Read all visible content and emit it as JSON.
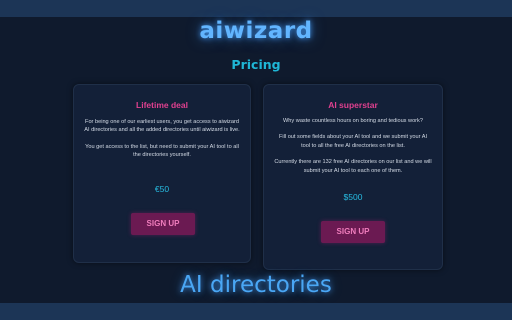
{
  "brand": "aiwizard",
  "pricing": {
    "heading": "Pricing",
    "plans": [
      {
        "title": "Lifetime deal",
        "paragraphs": [
          "For being one of our earliest users, you get access to aiwizard AI directories and all the added directories until aiwizard is live.",
          "You get access to the list, but need to submit your AI tool to all the directories yourself."
        ],
        "price": "€50",
        "cta": "SIGN UP"
      },
      {
        "title": "AI superstar",
        "paragraphs": [
          "Why waste countless hours on boring and tedious work?",
          "Fill out some fields about your AI tool and we submit your AI tool to all the free AI directories on the list.",
          "Currently there are 132 free AI directories on our list and we will submit your AI tool to each one of them."
        ],
        "price": "$500",
        "cta": "SIGN UP"
      }
    ]
  },
  "footer": {
    "title": "AI directories"
  },
  "colors": {
    "background": "#0f1a2d",
    "band": "#1c3556",
    "brand": "#62b5ff",
    "heading": "#1fb6d6",
    "plan_title": "#e0408f",
    "price": "#27bde3",
    "button_bg": "#6b1a52",
    "button_text": "#f07dbd"
  }
}
